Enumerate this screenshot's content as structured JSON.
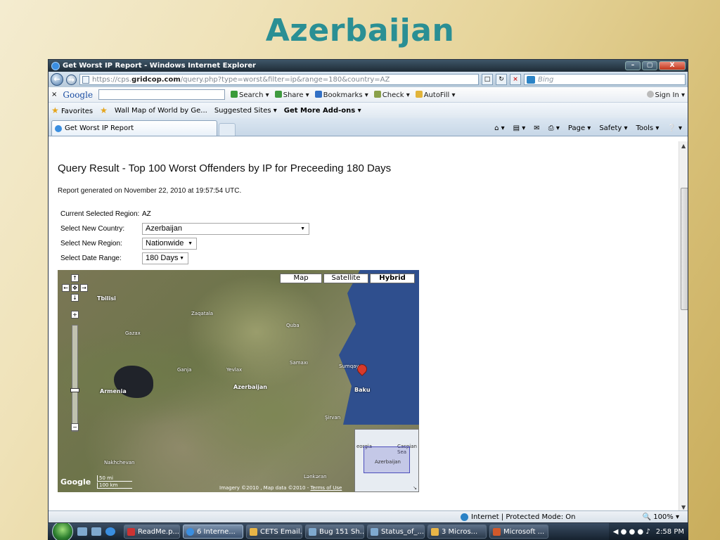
{
  "slide": {
    "title": "Azerbaijan"
  },
  "window": {
    "title": "Get Worst IP Report - Windows Internet Explorer",
    "buttons": {
      "minimize": "–",
      "maximize": "▢",
      "close": "X"
    }
  },
  "address_bar": {
    "url_prefix": "https://cps.",
    "url_domain": "gridcop.com",
    "url_rest": "/query.php?type=worst&filter=ip&range=180&country=AZ",
    "search_placeholder": "Bing"
  },
  "google_toolbar": {
    "logo": "Google",
    "items": [
      "Search ▾",
      "Share ▾",
      "Bookmarks ▾",
      "Check ▾",
      "AutoFill ▾",
      "Sign In ▾"
    ]
  },
  "favorites_bar": {
    "favorites_label": "Favorites",
    "items": [
      "Wall Map of World by Ge...",
      "Suggested Sites ▾",
      "Get More Add-ons ▾"
    ]
  },
  "tab": {
    "label": "Get Worst IP Report"
  },
  "command_bar": [
    "Page ▾",
    "Safety ▾",
    "Tools ▾"
  ],
  "page": {
    "heading": "Query Result - Top 100 Worst Offenders by IP for Preceeding 180 Days",
    "report_line": "Report generated on November 22, 2010 at 19:57:54 UTC.",
    "form": {
      "current_region_label": "Current Selected Region:",
      "current_region_value": "AZ",
      "country_label": "Select New Country:",
      "country_value": "Azerbaijan",
      "region_label": "Select New Region:",
      "region_value": "Nationwide",
      "date_label": "Select Date Range:",
      "date_value": "180 Days"
    }
  },
  "map": {
    "types": [
      "Map",
      "Satellite",
      "Hybrid"
    ],
    "selected_type": "Hybrid",
    "labels": {
      "tbilisi": "Tbilisi",
      "armenia": "Armenia",
      "azerbaijan": "Azerbaijan",
      "baku": "Baku",
      "samaxi": "Samaxı",
      "quba": "Quba",
      "ganja": "Ganja",
      "sumqayit": "Sumqayıt",
      "sirvan": "Şirvan",
      "lankaran": "Lənkəran",
      "nakhchivan": "Nakhchevan",
      "yevlax": "Yevlax",
      "gazax": "Gazax",
      "zaqatala": "Zaqatala",
      "caspian": "Caspian Sea",
      "overview_az": "Azerbaijan",
      "overview_georgia": "eorgia"
    },
    "scale": {
      "miles": "50 mi",
      "km": "100 km"
    },
    "copyright": "Imagery ©2010 , Map data ©2010 -",
    "terms": "Terms of Use",
    "watermark": "Google"
  },
  "status_bar": {
    "zone": "Internet | Protected Mode: On",
    "zoom": "100%"
  },
  "taskbar": {
    "items": [
      "ReadMe.p...",
      "6 Interne...",
      "CETS Email...",
      "Bug 151 Sh...",
      "Status_of_...",
      "3 Micros...",
      "Microsoft ..."
    ],
    "active_index": 1,
    "clock": "2:58 PM"
  }
}
